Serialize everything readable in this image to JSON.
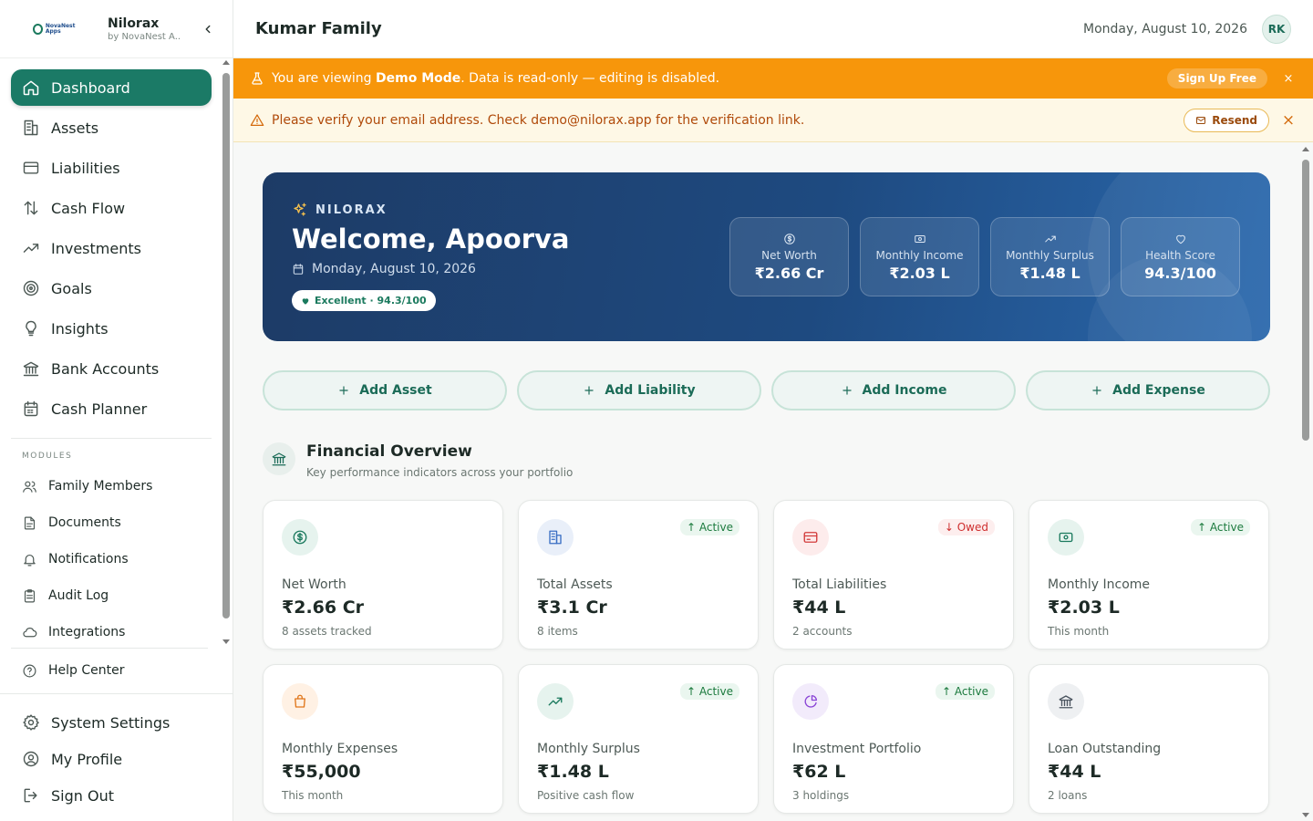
{
  "brand": {
    "logo_text": "NovaNest Apps",
    "name": "Nilorax",
    "sub": "by NovaNest A..."
  },
  "nav": {
    "main": [
      {
        "label": "Dashboard",
        "icon": "home-icon",
        "active": true
      },
      {
        "label": "Assets",
        "icon": "building-icon"
      },
      {
        "label": "Liabilities",
        "icon": "credit-card-icon"
      },
      {
        "label": "Cash Flow",
        "icon": "arrows-up-down-icon"
      },
      {
        "label": "Investments",
        "icon": "trending-up-icon"
      },
      {
        "label": "Goals",
        "icon": "target-icon"
      },
      {
        "label": "Insights",
        "icon": "lightbulb-icon"
      },
      {
        "label": "Bank Accounts",
        "icon": "bank-icon"
      },
      {
        "label": "Cash Planner",
        "icon": "calendar-icon"
      }
    ],
    "modules_label": "MODULES",
    "modules": [
      {
        "label": "Family Members",
        "icon": "users-icon"
      },
      {
        "label": "Documents",
        "icon": "document-icon"
      },
      {
        "label": "Notifications",
        "icon": "bell-icon"
      },
      {
        "label": "Audit Log",
        "icon": "clipboard-icon"
      },
      {
        "label": "Integrations",
        "icon": "cloud-icon"
      }
    ],
    "help": {
      "label": "Help Center",
      "icon": "help-circle-icon"
    },
    "bottom": [
      {
        "label": "System Settings",
        "icon": "gear-icon"
      },
      {
        "label": "My Profile",
        "icon": "user-circle-icon"
      },
      {
        "label": "Sign Out",
        "icon": "sign-out-icon"
      }
    ]
  },
  "topbar": {
    "title": "Kumar Family",
    "date": "Monday, August 10, 2026",
    "avatar": "RK"
  },
  "demo_banner": {
    "prefix": "You are viewing ",
    "mode": "Demo Mode",
    "suffix": ". Data is read-only — editing is disabled.",
    "signup_label": "Sign Up Free",
    "close": "×"
  },
  "verify_banner": {
    "text": "Please verify your email address. Check demo@nilorax.app for the verification link.",
    "resend_label": "Resend",
    "close": "×"
  },
  "hero": {
    "brand": "NILORAX",
    "title": "Welcome, Apoorva",
    "date": "Monday, August 10, 2026",
    "badge": "Excellent · 94.3/100",
    "stats": [
      {
        "label": "Net Worth",
        "value": "₹2.66 Cr",
        "icon": "dollar-circle-icon"
      },
      {
        "label": "Monthly Income",
        "value": "₹2.03 L",
        "icon": "banknote-icon"
      },
      {
        "label": "Monthly Surplus",
        "value": "₹1.48 L",
        "icon": "trending-up-icon"
      },
      {
        "label": "Health Score",
        "value": "94.3/100",
        "icon": "heart-icon"
      }
    ]
  },
  "actions": [
    {
      "label": "Add Asset"
    },
    {
      "label": "Add Liability"
    },
    {
      "label": "Add Income"
    },
    {
      "label": "Add Expense"
    }
  ],
  "overview": {
    "title": "Financial Overview",
    "subtitle": "Key performance indicators across your portfolio"
  },
  "cards": [
    {
      "label": "Net Worth",
      "value": "₹2.66 Cr",
      "foot": "8 assets tracked",
      "icon": "dollar-circle-icon",
      "badge": null,
      "tint": "#e6f3ee",
      "color": "#1b7a5e"
    },
    {
      "label": "Total Assets",
      "value": "₹3.1 Cr",
      "foot": "8 items",
      "icon": "building-icon",
      "badge": {
        "text": "Active",
        "dir": "up"
      },
      "tint": "#e9eff9",
      "color": "#3a6fc4"
    },
    {
      "label": "Total Liabilities",
      "value": "₹44 L",
      "foot": "2 accounts",
      "icon": "credit-card-icon",
      "badge": {
        "text": "Owed",
        "dir": "down"
      },
      "tint": "#fdecec",
      "color": "#d23b3b"
    },
    {
      "label": "Monthly Income",
      "value": "₹2.03 L",
      "foot": "This month",
      "icon": "banknote-icon",
      "badge": {
        "text": "Active",
        "dir": "up"
      },
      "tint": "#e6f3ee",
      "color": "#1b7a5e"
    },
    {
      "label": "Monthly Expenses",
      "value": "₹55,000",
      "foot": "This month",
      "icon": "shopping-bag-icon",
      "badge": null,
      "tint": "#fff1e4",
      "color": "#e0761a"
    },
    {
      "label": "Monthly Surplus",
      "value": "₹1.48 L",
      "foot": "Positive cash flow",
      "icon": "trending-up-icon",
      "badge": {
        "text": "Active",
        "dir": "up"
      },
      "tint": "#e6f3ee",
      "color": "#1b7a5e"
    },
    {
      "label": "Investment Portfolio",
      "value": "₹62 L",
      "foot": "3 holdings",
      "icon": "pie-chart-icon",
      "badge": {
        "text": "Active",
        "dir": "up"
      },
      "tint": "#f2ebfb",
      "color": "#8a44d6"
    },
    {
      "label": "Loan Outstanding",
      "value": "₹44 L",
      "foot": "2 loans",
      "icon": "bank-icon",
      "badge": null,
      "tint": "#eef0f2",
      "color": "#4b5560"
    }
  ]
}
